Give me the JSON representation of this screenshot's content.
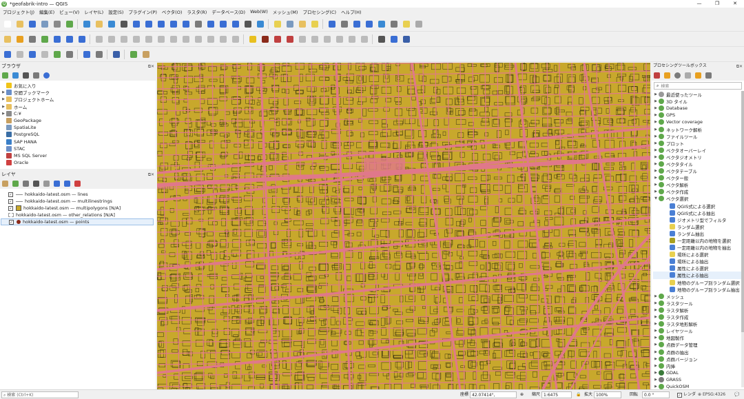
{
  "window": {
    "title": "*geofabrik-intro — QGIS",
    "controls": [
      "—",
      "❐",
      "✕"
    ]
  },
  "menu": [
    "プロジェクト(J)",
    "編集(E)",
    "ビュー(V)",
    "レイヤ(L)",
    "設定(S)",
    "プラグイン(P)",
    "ベクタ(O)",
    "ラスタ(R)",
    "データベース(D)",
    "Web(W)",
    "メッシュ(M)",
    "プロセシング(C)",
    "ヘルプ(H)"
  ],
  "browser": {
    "title": "ブラウザ",
    "items": [
      {
        "label": "お気に入り",
        "icon": "star-icon",
        "color": "#f0c419",
        "expand": ""
      },
      {
        "label": "空間ブックマーク",
        "icon": "bookmark-icon",
        "color": "#6a8fc8",
        "expand": "▶"
      },
      {
        "label": "プロジェクトホーム",
        "icon": "folder-icon",
        "color": "#e8c060",
        "expand": "▶"
      },
      {
        "label": "ホーム",
        "icon": "home-icon",
        "color": "#e8c060",
        "expand": "▶"
      },
      {
        "label": "C:¥",
        "icon": "drive-icon",
        "color": "#8a8a8a",
        "expand": "▶"
      },
      {
        "label": "GeoPackage",
        "icon": "geopackage-icon",
        "color": "#c8a060",
        "expand": ""
      },
      {
        "label": "SpatiaLite",
        "icon": "spatialite-icon",
        "color": "#7a9ac0",
        "expand": ""
      },
      {
        "label": "PostgreSQL",
        "icon": "postgresql-icon",
        "color": "#3a6ea5",
        "expand": ""
      },
      {
        "label": "SAP HANA",
        "icon": "sap-hana-icon",
        "color": "#3a7fc8",
        "expand": ""
      },
      {
        "label": "STAC",
        "icon": "stac-icon",
        "color": "#6a8fc8",
        "expand": ""
      },
      {
        "label": "MS SQL Server",
        "icon": "mssql-icon",
        "color": "#c04040",
        "expand": ""
      },
      {
        "label": "Oracle",
        "icon": "oracle-icon",
        "color": "#d04040",
        "expand": ""
      }
    ]
  },
  "layers": {
    "title": "レイヤ",
    "items": [
      {
        "label": "hokkaido-latest.osm — lines",
        "checked": "✓",
        "symbol": "line",
        "color": "#8a8a8a"
      },
      {
        "label": "hokkaido-latest.osm — multilinestrings",
        "checked": "✓",
        "symbol": "line",
        "color": "#8a8a8a"
      },
      {
        "label": "hokkaido-latest.osm — multipolygons [N/A]",
        "checked": "✓",
        "symbol": "fill",
        "color": "#c8a82c"
      },
      {
        "label": "hokkaido-latest.osm — other_relations [N/A]",
        "checked": "",
        "symbol": "none",
        "color": "#999999"
      },
      {
        "label": "hokkaido-latest.osm — points",
        "checked": "✓",
        "symbol": "point",
        "color": "#8b2a1a"
      }
    ]
  },
  "processing": {
    "title": "プロセシングツールボックス",
    "search_placeholder": "検索",
    "items": [
      {
        "label": "最近使ったツール",
        "expand": "▶",
        "sub": false,
        "icon": "clock-icon",
        "color": "#999999"
      },
      {
        "label": "3D タイル",
        "expand": "▶",
        "sub": false,
        "icon": "qgis-icon",
        "color": "#5fa84b"
      },
      {
        "label": "Database",
        "expand": "▶",
        "sub": false,
        "icon": "qgis-icon",
        "color": "#5fa84b"
      },
      {
        "label": "GPS",
        "expand": "▶",
        "sub": false,
        "icon": "qgis-icon",
        "color": "#5fa84b"
      },
      {
        "label": "Vector coverage",
        "expand": "▶",
        "sub": false,
        "icon": "qgis-icon",
        "color": "#5fa84b"
      },
      {
        "label": "ネットワーク解析",
        "expand": "▶",
        "sub": false,
        "icon": "qgis-icon",
        "color": "#5fa84b"
      },
      {
        "label": "ファイルツール",
        "expand": "▶",
        "sub": false,
        "icon": "qgis-icon",
        "color": "#5fa84b"
      },
      {
        "label": "プロット",
        "expand": "▶",
        "sub": false,
        "icon": "qgis-icon",
        "color": "#5fa84b"
      },
      {
        "label": "ベクタオーバーレイ",
        "expand": "▶",
        "sub": false,
        "icon": "qgis-icon",
        "color": "#5fa84b"
      },
      {
        "label": "ベクタジオメトリ",
        "expand": "▶",
        "sub": false,
        "icon": "qgis-icon",
        "color": "#5fa84b"
      },
      {
        "label": "ベクタタイル",
        "expand": "▶",
        "sub": false,
        "icon": "qgis-icon",
        "color": "#5fa84b"
      },
      {
        "label": "ベクタテーブル",
        "expand": "▶",
        "sub": false,
        "icon": "qgis-icon",
        "color": "#5fa84b"
      },
      {
        "label": "ベクター般",
        "expand": "▶",
        "sub": false,
        "icon": "qgis-icon",
        "color": "#5fa84b"
      },
      {
        "label": "ベクタ解析",
        "expand": "▶",
        "sub": false,
        "icon": "qgis-icon",
        "color": "#5fa84b"
      },
      {
        "label": "ベクタ作成",
        "expand": "▶",
        "sub": false,
        "icon": "qgis-icon",
        "color": "#5fa84b"
      },
      {
        "label": "ベクタ選択",
        "expand": "▼",
        "sub": false,
        "icon": "qgis-icon",
        "color": "#5fa84b"
      },
      {
        "label": "QGIS式による選択",
        "expand": "",
        "sub": true,
        "icon": "gear-icon",
        "color": "#4a7fd4"
      },
      {
        "label": "QGIS式による抽出",
        "expand": "",
        "sub": true,
        "icon": "gear-icon",
        "color": "#4a7fd4"
      },
      {
        "label": "ジオメトリ型でフィルタ",
        "expand": "",
        "sub": true,
        "icon": "gear-icon",
        "color": "#4a7fd4"
      },
      {
        "label": "ランダム選択",
        "expand": "",
        "sub": true,
        "icon": "select-icon",
        "color": "#e8d050"
      },
      {
        "label": "ランダム抽出",
        "expand": "",
        "sub": true,
        "icon": "gear-icon",
        "color": "#4a7fd4"
      },
      {
        "label": "一定距離以内の地物を選択",
        "expand": "",
        "sub": true,
        "icon": "select-icon",
        "color": "#a8a020"
      },
      {
        "label": "一定距離以内の地物を抽出",
        "expand": "",
        "sub": true,
        "icon": "gear-icon",
        "color": "#4a7fd4"
      },
      {
        "label": "場所による選択",
        "expand": "",
        "sub": true,
        "icon": "select-icon",
        "color": "#e8d050"
      },
      {
        "label": "場所による抽出",
        "expand": "",
        "sub": true,
        "icon": "gear-icon",
        "color": "#4a7fd4"
      },
      {
        "label": "属性による選択",
        "expand": "",
        "sub": true,
        "icon": "gear-icon",
        "color": "#4a7fd4"
      },
      {
        "label": "属性による抽出",
        "expand": "",
        "sub": true,
        "icon": "gear-icon",
        "color": "#4a7fd4"
      },
      {
        "label": "地物のグループ別ランダム選択",
        "expand": "",
        "sub": true,
        "icon": "select-icon",
        "color": "#e8d050"
      },
      {
        "label": "地物のグループ別ランダム抽出",
        "expand": "",
        "sub": true,
        "icon": "gear-icon",
        "color": "#4a7fd4"
      },
      {
        "label": "メッシュ",
        "expand": "▶",
        "sub": false,
        "icon": "qgis-icon",
        "color": "#5fa84b"
      },
      {
        "label": "ラスタツール",
        "expand": "▶",
        "sub": false,
        "icon": "qgis-icon",
        "color": "#5fa84b"
      },
      {
        "label": "ラスタ解析",
        "expand": "▶",
        "sub": false,
        "icon": "qgis-icon",
        "color": "#5fa84b"
      },
      {
        "label": "ラスタ作成",
        "expand": "▶",
        "sub": false,
        "icon": "qgis-icon",
        "color": "#5fa84b"
      },
      {
        "label": "ラスタ地形解析",
        "expand": "▶",
        "sub": false,
        "icon": "qgis-icon",
        "color": "#5fa84b"
      },
      {
        "label": "レイヤツール",
        "expand": "▶",
        "sub": false,
        "icon": "qgis-icon",
        "color": "#5fa84b"
      },
      {
        "label": "地図製作",
        "expand": "▶",
        "sub": false,
        "icon": "qgis-icon",
        "color": "#5fa84b"
      },
      {
        "label": "点群データ管理",
        "expand": "▶",
        "sub": false,
        "icon": "qgis-icon",
        "color": "#5fa84b"
      },
      {
        "label": "点群の抽出",
        "expand": "▶",
        "sub": false,
        "icon": "qgis-icon",
        "color": "#5fa84b"
      },
      {
        "label": "点群バージョン",
        "expand": "▶",
        "sub": false,
        "icon": "qgis-icon",
        "color": "#5fa84b"
      },
      {
        "label": "内挿",
        "expand": "▶",
        "sub": false,
        "icon": "qgis-icon",
        "color": "#5fa84b"
      },
      {
        "label": "GDAL",
        "expand": "▶",
        "sub": false,
        "icon": "gdal-icon",
        "color": "#3a7a3a"
      },
      {
        "label": "GRASS",
        "expand": "▶",
        "sub": false,
        "icon": "grass-icon",
        "color": "#7a7a7a"
      },
      {
        "label": "QuickOSM",
        "expand": "▶",
        "sub": false,
        "icon": "qgis-icon",
        "color": "#5fa84b"
      }
    ]
  },
  "statusbar": {
    "search_placeholder": "検索 (Ctrl+K)",
    "coord_label": "座標",
    "coord_value": "42.07414°, 141.20957°",
    "scale_label": "縮尺",
    "scale_value": "1:6475",
    "magnifier_label": "拡大",
    "magnifier_value": "100%",
    "rotation_label": "回転",
    "rotation_value": "0.0 °",
    "render_label": "レンダ",
    "crs": "EPSG:4326"
  },
  "map": {
    "background": "#c8a82c",
    "road_color": "#e0788a",
    "outline_color": "#3a3410"
  }
}
